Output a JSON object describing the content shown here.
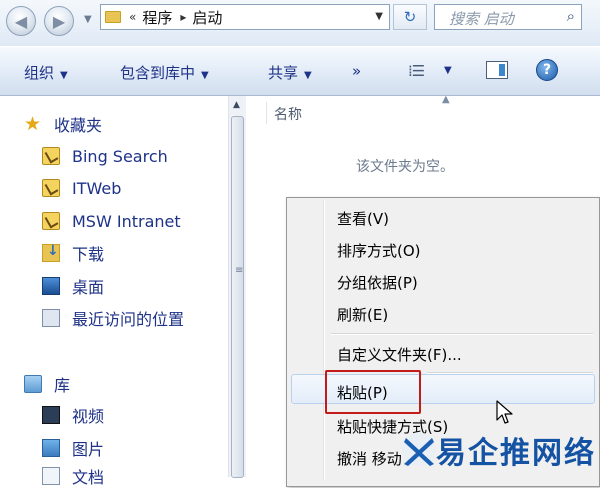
{
  "address_bar": {
    "breadcrumb_prefix": "«",
    "breadcrumb": [
      "程序",
      "启动"
    ],
    "search_placeholder": "搜索 启动"
  },
  "toolbar": {
    "organize": "组织",
    "include_in_library": "包含到库中",
    "share": "共享",
    "more": "»"
  },
  "nav_pane": {
    "favorites": {
      "label": "收藏夹",
      "items": [
        "Bing Search",
        "ITWeb",
        "MSW Intranet",
        "下载",
        "桌面",
        "最近访问的位置"
      ]
    },
    "libraries": {
      "label": "库",
      "items": [
        "视频",
        "图片",
        "文档"
      ]
    }
  },
  "content": {
    "column_header": "名称",
    "empty_message": "该文件夹为空。"
  },
  "context_menu": {
    "items": [
      "查看(V)",
      "排序方式(O)",
      "分组依据(P)",
      "刷新(E)",
      "自定义文件夹(F)...",
      "粘贴(P)",
      "粘贴快捷方式(S)",
      "撤消 移动"
    ],
    "highlighted": "粘贴(P)"
  },
  "watermark": {
    "text": "易企推网络"
  },
  "colors": {
    "toolbar_text": "#1e3287",
    "highlight_box": "#c31a1a",
    "watermark": "#1452a3"
  }
}
